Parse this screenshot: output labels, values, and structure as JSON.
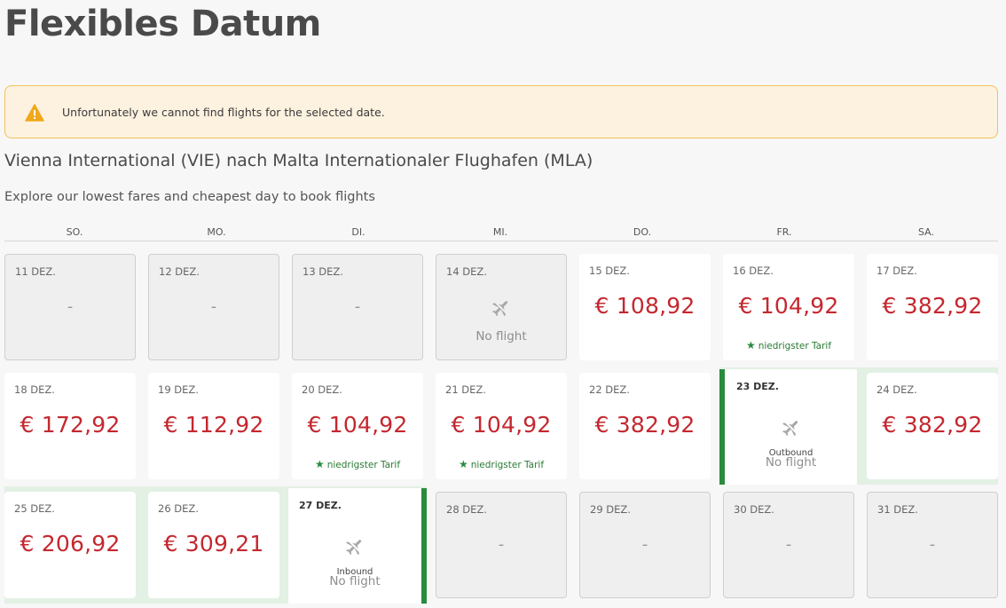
{
  "page": {
    "title": "Flexibles Datum",
    "alert_text": "Unfortunately we cannot find flights for the selected date.",
    "route": "Vienna International (VIE) nach Malta Internationaler Flughafen (MLA)",
    "subtitle": "Explore our lowest fares and cheapest day to book flights"
  },
  "colors": {
    "price": "#c4282f",
    "accent_green": "#2a8a3e",
    "alert_bg": "#fdf2e0",
    "alert_border": "#f2c25a"
  },
  "weekdays": [
    "SO.",
    "MO.",
    "DI.",
    "MI.",
    "DO.",
    "FR.",
    "SA."
  ],
  "calendar": {
    "row1": [
      {
        "date": "11 DEZ.",
        "value": "-"
      },
      {
        "date": "12 DEZ.",
        "value": "-"
      },
      {
        "date": "13 DEZ.",
        "value": "-"
      },
      {
        "date": "14 DEZ.",
        "value": "No flight"
      },
      {
        "date": "15 DEZ.",
        "price": "€  108,92"
      },
      {
        "date": "16 DEZ.",
        "price": "€  104,92",
        "tag": "niedrigster Tarif"
      },
      {
        "date": "17 DEZ.",
        "price": "€  382,92"
      }
    ],
    "row2": [
      {
        "date": "18 DEZ.",
        "price": "€  172,92"
      },
      {
        "date": "19 DEZ.",
        "price": "€  112,92"
      },
      {
        "date": "20 DEZ.",
        "price": "€  104,92",
        "tag": "niedrigster Tarif"
      },
      {
        "date": "21 DEZ.",
        "price": "€  104,92",
        "tag": "niedrigster Tarif"
      },
      {
        "date": "22 DEZ.",
        "price": "€  382,92"
      },
      {
        "date": "23 DEZ.",
        "direction": "Outbound",
        "value": "No flight"
      },
      {
        "date": "24 DEZ.",
        "price": "€  382,92"
      }
    ],
    "row3": [
      {
        "date": "25 DEZ.",
        "price": "€  206,92"
      },
      {
        "date": "26 DEZ.",
        "price": "€  309,21"
      },
      {
        "date": "27 DEZ.",
        "direction": "Inbound",
        "value": "No flight"
      },
      {
        "date": "28 DEZ.",
        "value": "-"
      },
      {
        "date": "29 DEZ.",
        "value": "-"
      },
      {
        "date": "30 DEZ.",
        "value": "-"
      },
      {
        "date": "31 DEZ.",
        "value": "-"
      }
    ]
  }
}
